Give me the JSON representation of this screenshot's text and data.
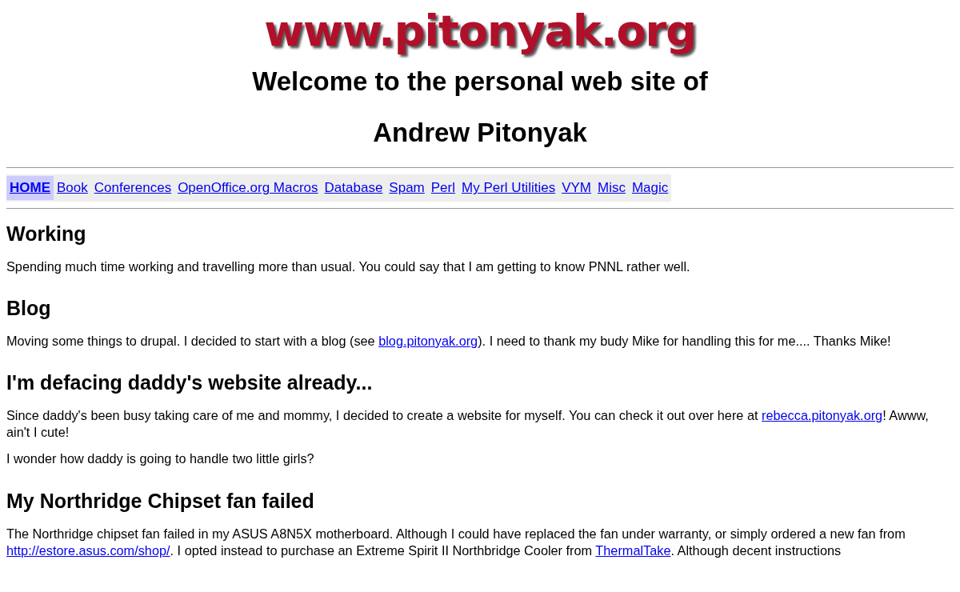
{
  "logo": "www.pitonyak.org",
  "title_lines": [
    "Welcome to the personal web site of",
    "Andrew Pitonyak"
  ],
  "nav": [
    {
      "label": "HOME",
      "selected": true
    },
    {
      "label": "Book",
      "selected": false
    },
    {
      "label": "Conferences",
      "selected": false
    },
    {
      "label": "OpenOffice.org Macros",
      "selected": false
    },
    {
      "label": "Database",
      "selected": false
    },
    {
      "label": "Spam",
      "selected": false
    },
    {
      "label": "Perl",
      "selected": false
    },
    {
      "label": "My Perl Utilities",
      "selected": false
    },
    {
      "label": "VYM",
      "selected": false
    },
    {
      "label": "Misc",
      "selected": false
    },
    {
      "label": "Magic",
      "selected": false
    }
  ],
  "sections": [
    {
      "heading": "Working",
      "paragraphs": [
        [
          {
            "text": "Spending much time working and travelling more than usual. You could say that I am getting to know PNNL rather well."
          }
        ]
      ]
    },
    {
      "heading": "Blog",
      "paragraphs": [
        [
          {
            "text": "Moving some things to drupal. I decided to start with a blog (see "
          },
          {
            "link": "blog.pitonyak.org"
          },
          {
            "text": "). I need to thank my budy Mike for handling this for me.... Thanks Mike!"
          }
        ]
      ]
    },
    {
      "heading": "I'm defacing daddy's website already...",
      "paragraphs": [
        [
          {
            "text": "Since daddy's been busy taking care of me and mommy, I decided to create a website for myself. You can check it out over here at "
          },
          {
            "link": "rebecca.pitonyak.org"
          },
          {
            "text": "! Awww, ain't I cute!"
          }
        ],
        [
          {
            "text": "I wonder how daddy is going to handle two little girls?"
          }
        ]
      ]
    },
    {
      "heading": "My Northridge Chipset fan failed",
      "paragraphs": [
        [
          {
            "text": "The Northridge chipset fan failed in my ASUS A8N5X motherboard. Although I could have replaced the fan under warranty, or simply ordered a new fan from "
          },
          {
            "link": "http://estore.asus.com/shop/"
          },
          {
            "text": ". I opted instead to purchase an Extreme Spirit II Northbridge Cooler from "
          },
          {
            "link": "ThermalTake"
          },
          {
            "text": ". Although decent instructions"
          }
        ]
      ]
    }
  ]
}
